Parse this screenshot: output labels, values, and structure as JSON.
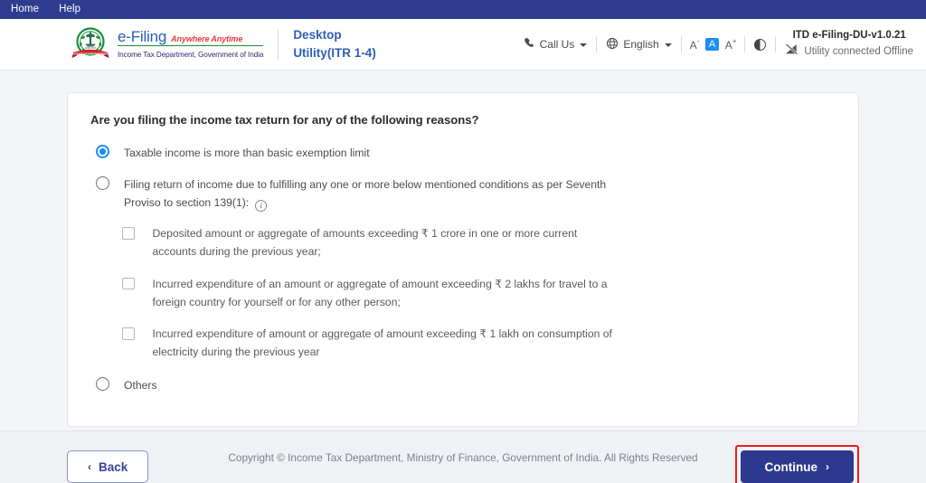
{
  "menubar": {
    "items": [
      {
        "label": "Home"
      },
      {
        "label": "Help"
      }
    ]
  },
  "header": {
    "brand": {
      "name": "e-Filing",
      "tagline": "Anywhere Anytime",
      "department": "Income Tax Department, Government of India",
      "emblem_icon": "india-national-emblem-income-tax-icon"
    },
    "app_title_line1": "Desktop",
    "app_title_line2": "Utility(ITR 1-4)",
    "tools": {
      "call_us": {
        "label": "Call Us",
        "icon": "phone-icon"
      },
      "language": {
        "label": "English",
        "icon": "globe-icon"
      },
      "font_decrease": {
        "label": "A",
        "sup": "-",
        "icon": "font-decrease-icon"
      },
      "font_normal": {
        "label": "A",
        "icon": "font-normal-icon",
        "active_color": "#1a8ef5"
      },
      "font_increase": {
        "label": "A",
        "sup": "+",
        "icon": "font-increase-icon"
      },
      "contrast": {
        "icon": "contrast-toggle-icon"
      }
    },
    "version": {
      "title": "ITD e-Filing-DU-v1.0.21",
      "status": "Utility connected Offline",
      "status_icon": "signal-offline-icon"
    }
  },
  "main": {
    "question": "Are you filing the income tax return for any of the following reasons?",
    "options": [
      {
        "id": "taxable-income",
        "label": "Taxable income is more than basic exemption limit",
        "selected": true,
        "has_info": false
      },
      {
        "id": "seventh-proviso",
        "label": "Filing return of income due to fulfilling any one or more below mentioned conditions as per Seventh Proviso to section 139(1):",
        "selected": false,
        "has_info": true,
        "info_icon": "info-icon"
      },
      {
        "id": "others",
        "label": "Others",
        "selected": false,
        "has_info": false
      }
    ],
    "sub_conditions": [
      {
        "id": "deposit-1-crore",
        "label": "Deposited amount or aggregate of amounts exceeding ₹ 1 crore in one or more current accounts during the previous year;",
        "checked": false
      },
      {
        "id": "foreign-travel-2-lakhs",
        "label": "Incurred expenditure of an amount or aggregate of amount exceeding ₹ 2 lakhs for travel to a foreign country for yourself or for any other person;",
        "checked": false
      },
      {
        "id": "electricity-1-lakh",
        "label": "Incurred expenditure of amount or aggregate of amount exceeding ₹ 1 lakh on consumption of electricity during the previous year",
        "checked": false
      }
    ]
  },
  "actions": {
    "back": {
      "label": "Back",
      "icon": "chevron-left-icon"
    },
    "continue": {
      "label": "Continue",
      "icon": "chevron-right-icon",
      "highlight_color": "#ee1c25",
      "background_color": "#2b3a8f"
    }
  },
  "footer": {
    "copyright": "Copyright © Income Tax Department, Ministry of Finance, Government of India. All Rights Reserved"
  }
}
